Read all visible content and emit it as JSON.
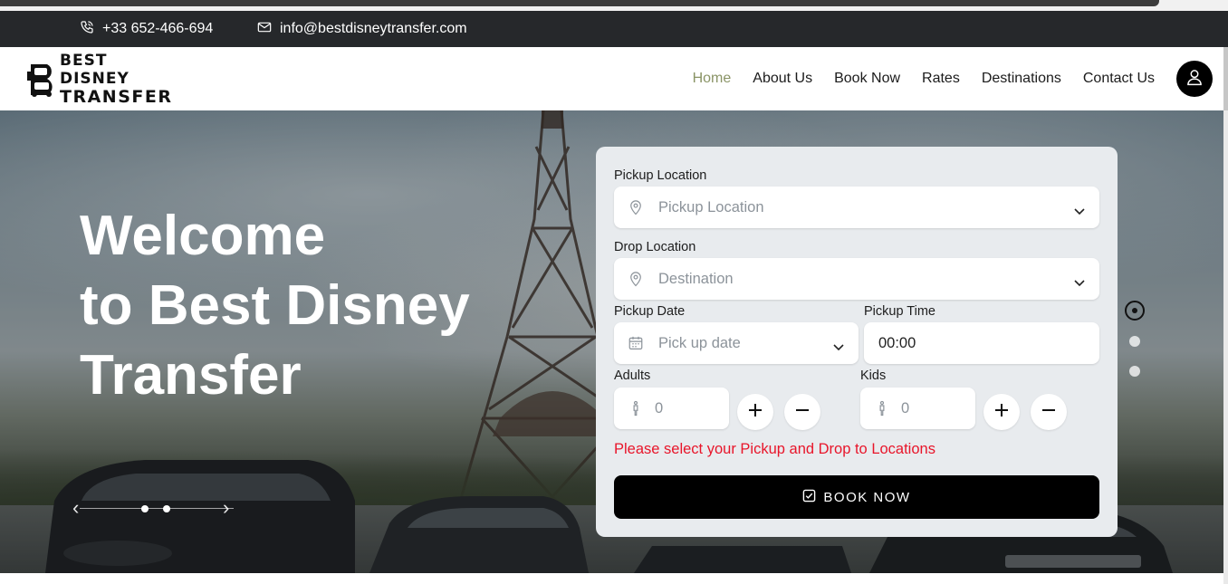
{
  "topbar": {
    "phone": "+33 652-466-694",
    "email": "info@bestdisneytransfer.com",
    "phone_icon": "phone-icon",
    "email_icon": "envelope-icon"
  },
  "brand": {
    "line1": "BEST DISNEY",
    "line2": "TRANSFER"
  },
  "nav": {
    "items": [
      "Home",
      "About Us",
      "Book Now",
      "Rates",
      "Destinations",
      "Contact Us"
    ],
    "active": "Home",
    "active_color": "#8a9466",
    "account_icon": "user-icon"
  },
  "hero": {
    "title_lines": [
      "Welcome",
      "to Best Disney",
      "Transfer"
    ]
  },
  "booking": {
    "pickup_label": "Pickup Location",
    "pickup_placeholder": "Pickup Location",
    "drop_label": "Drop Location",
    "drop_placeholder": "Destination",
    "date_label": "Pickup Date",
    "date_placeholder": "Pick up date",
    "time_label": "Pickup Time",
    "time_value": "00:00",
    "adults_label": "Adults",
    "adults_value": "0",
    "kids_label": "Kids",
    "kids_value": "0",
    "error": "Please select your Pickup and Drop to Locations",
    "error_color": "#e8152a",
    "submit": "BOOK NOW"
  }
}
